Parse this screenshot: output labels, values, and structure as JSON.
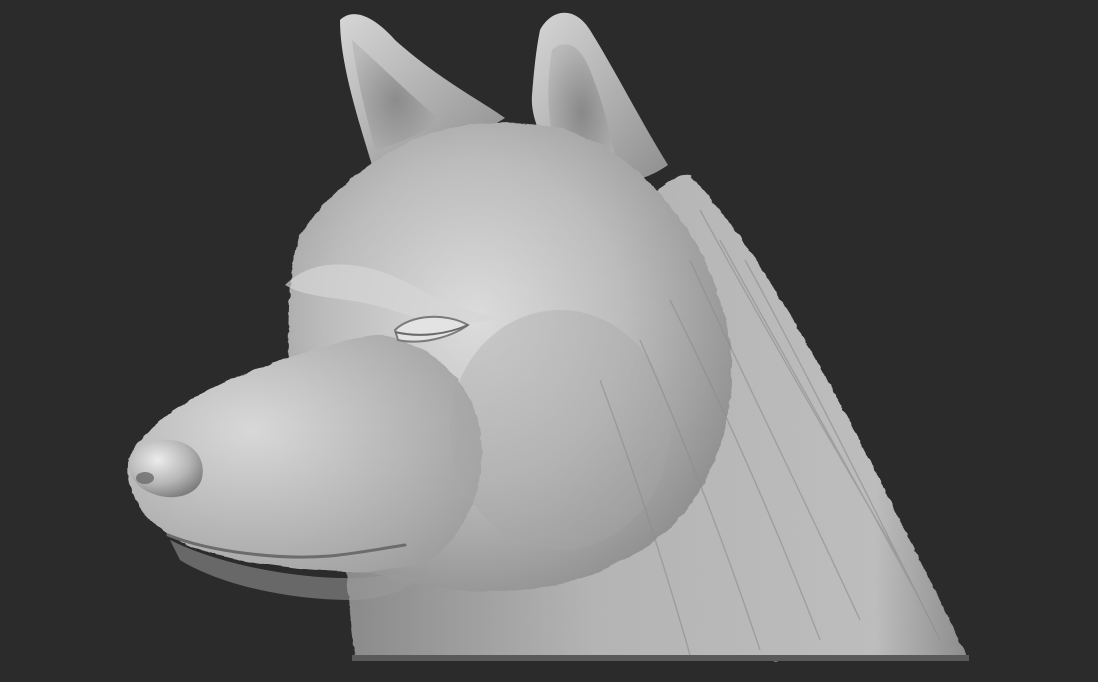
{
  "scene": {
    "background_color": "#2b2b2b",
    "subject": "wolf-head-sculpt",
    "material_color": "#a8a8a8",
    "highlight_color": "#e2e2e2",
    "shadow_color": "#555555"
  }
}
